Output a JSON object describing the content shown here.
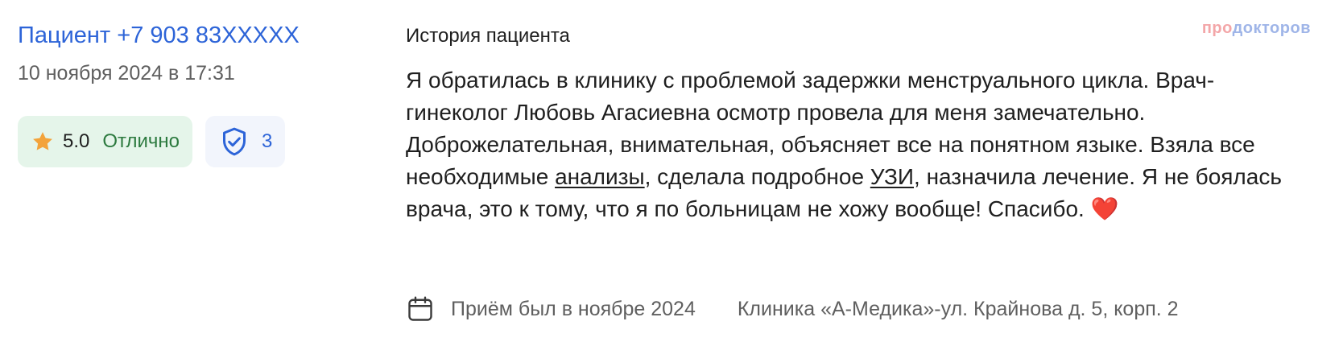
{
  "author": {
    "name": "Пациент +7 903 83XXXXX",
    "date": "10 ноября 2024 в 17:31"
  },
  "rating": {
    "value": "5.0",
    "label": "Отлично",
    "star_color": "#f3a33b",
    "trust_count": "3",
    "icons": [
      "star-icon",
      "shield-check-icon"
    ]
  },
  "brand": {
    "part1": "про",
    "part2": "докторов"
  },
  "review": {
    "title": "История пациента",
    "segment_1": "Я обратилась в клинику с проблемой задержки менструального цикла. Врач-гинеколог Любовь Агасиевна осмотр провела для меня замечательно. Доброжелательная, внимательная, объясняет все на понятном языке. Взяла все необходимые ",
    "link_1": "анализы",
    "segment_2": ", сделала подробное ",
    "link_2": "УЗИ",
    "segment_3": ", назначила лечение. Я не боялась врача, это к тому, что я по больницам не хожу вообще! Спасибо. ",
    "emoji": "❤️"
  },
  "footer": {
    "visit": "Приём был в ноябре 2024",
    "clinic": "Клиника «А-Медика»-ул. Крайнова д. 5, корп. 2",
    "icon": "calendar-icon"
  },
  "colors": {
    "link": "#2d64d8",
    "rating_bg": "#e5f5ea",
    "rating_label": "#2c7a3f",
    "trust_bg": "#f2f5fc"
  }
}
